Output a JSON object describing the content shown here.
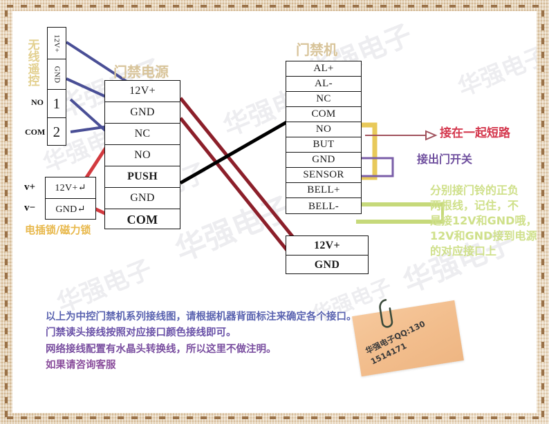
{
  "diagram": {
    "title_remote": "无线遥控",
    "title_power": "门禁电源",
    "title_controller": "门禁机",
    "title_lock": "电插锁/磁力锁"
  },
  "remote_block": {
    "rows": [
      "12V+",
      "GND",
      "1",
      "2"
    ],
    "side_labels": [
      "NO",
      "COM"
    ]
  },
  "power_block": {
    "title": "门禁电源",
    "rows": [
      "12V+",
      "GND",
      "NC",
      "NO",
      "PUSH",
      "GND",
      "COM"
    ]
  },
  "controller_block": {
    "title": "门禁机",
    "rows": [
      "AL+",
      "AL-",
      "NC",
      "COM",
      "NO",
      "BUT",
      "GND",
      "SENSOR",
      "BELL+",
      "BELL-"
    ]
  },
  "controller_power_block": {
    "rows": [
      "12V+",
      "GND"
    ]
  },
  "lock_block": {
    "rows": [
      "12V+↵",
      "GND↵"
    ],
    "side_labels": [
      "v+",
      "v−"
    ],
    "caption": "电插锁/磁力锁"
  },
  "annotations": {
    "short_circuit": "接在一起短路",
    "exit_switch": "接出门开关",
    "bell_note_line1": "分别接门铃的正负",
    "bell_note_line2": "两根线，记住，不",
    "bell_note_line3": "是接12V和GND哦，",
    "bell_note_line4": "12V和GND接到电源",
    "bell_note_line5": "的对应接口上"
  },
  "footer": {
    "line1": "以上为中控门禁机系列接线图，请根据机器背面标注来确定各个接口。",
    "line2": "门禁读头接线按照对应接口颜色接线即可。",
    "line3": "网络接线配置有水晶头转换线，所以这里不做注明。",
    "line4": "如果请咨询客服"
  },
  "sticky_note": {
    "line1": "华强电子QQ:130",
    "line2": "1514171"
  },
  "watermark": {
    "text": "华强电子"
  },
  "colors": {
    "wire_blue": "#4a4f96",
    "wire_red": "#d23a3f",
    "wire_darkred": "#8c1f2a",
    "wire_black": "#000000",
    "wire_yellow": "#e8c95a",
    "wire_purple": "#7a5ea8",
    "wire_green": "#c6d97a",
    "title_tan": "#d8c49a",
    "frame_tan": "#e0c9a6"
  }
}
